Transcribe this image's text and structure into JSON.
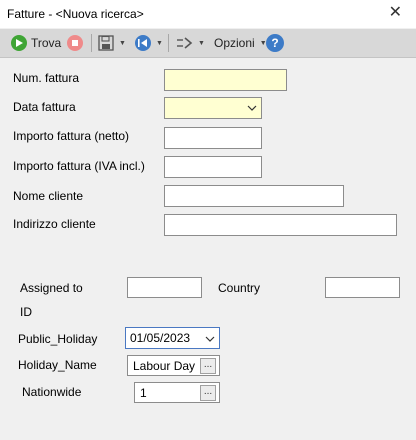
{
  "window": {
    "title": "Fatture - <Nuova ricerca>",
    "close_glyph": "✕"
  },
  "toolbar": {
    "search_label": "Trova",
    "options_label": "Opzioni",
    "help_glyph": "?"
  },
  "form": {
    "invoice_number": {
      "label": "Num. fattura",
      "value": ""
    },
    "invoice_date": {
      "label": "Data fattura",
      "value": ""
    },
    "amount_net": {
      "label": "Importo fattura (netto)",
      "value": ""
    },
    "amount_gross": {
      "label": "Importo fattura (IVA incl.)",
      "value": ""
    },
    "customer_name": {
      "label": "Nome cliente",
      "value": ""
    },
    "customer_address": {
      "label": "Indirizzo cliente",
      "value": ""
    },
    "assigned_to_id": {
      "label_line1": "Assigned to",
      "label_line2": "ID",
      "value": ""
    },
    "country": {
      "label": "Country",
      "value": ""
    },
    "public_holiday": {
      "label": "Public_Holiday",
      "value": "01/05/2023"
    },
    "holiday_name": {
      "label": "Holiday_Name",
      "value": "Labour Day",
      "button": "..."
    },
    "nationwide": {
      "label": "Nationwide",
      "value": "1",
      "button": "..."
    }
  },
  "colors": {
    "toolbar_bg": "#d8d8d8",
    "highlight_field": "#ffffd2",
    "play_icon": "#3fa535",
    "stop_icon": "#ef8a8a",
    "nav_icon": "#3d7bc7",
    "help_icon": "#3d7bc7"
  }
}
